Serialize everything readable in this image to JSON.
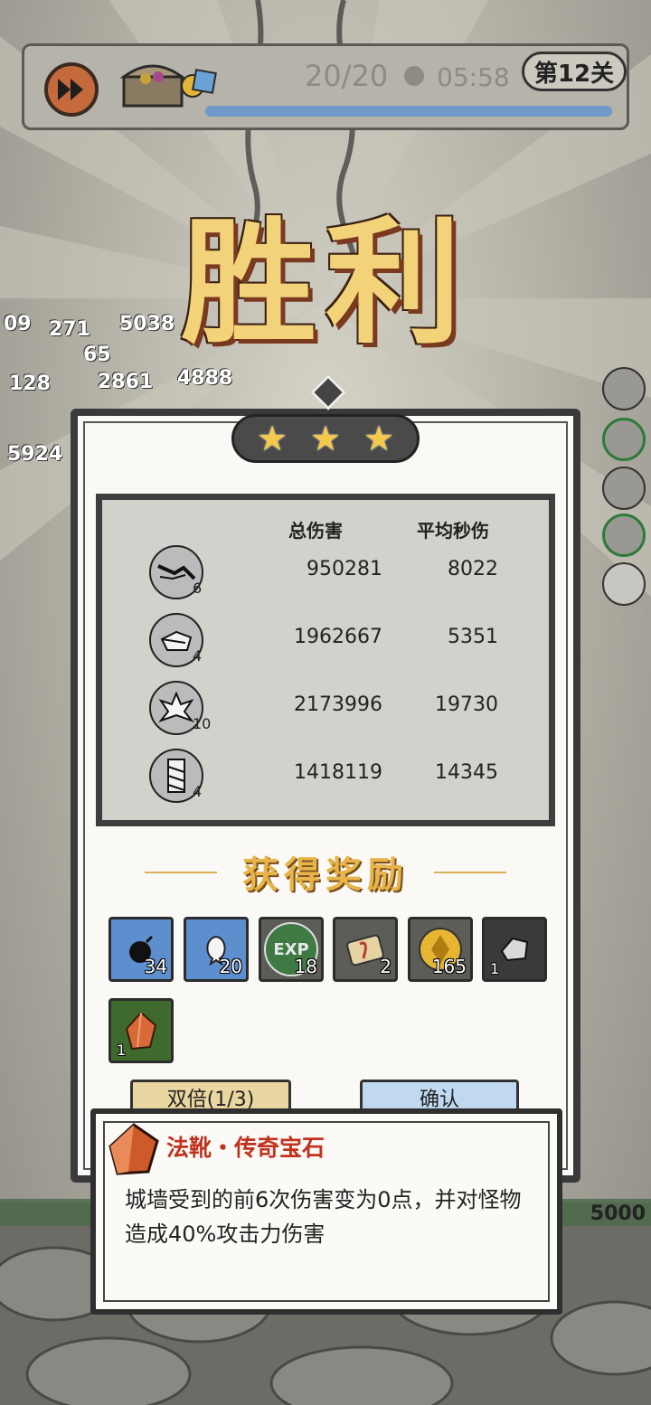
{
  "hud": {
    "wave": "20/20",
    "time": "05:58",
    "stage": "第12关"
  },
  "victory_text": "胜利",
  "floating_numbers": [
    "09",
    "271",
    "5038",
    "65",
    "2861",
    "4888",
    "128",
    "5924"
  ],
  "stars": 3,
  "stats": {
    "headers": [
      "总伤害",
      "平均秒伤"
    ],
    "rows": [
      {
        "icon": "crack-skill-icon",
        "level": "6",
        "total": "950281",
        "dps": "8022"
      },
      {
        "icon": "block-skill-icon",
        "level": "4",
        "total": "1962667",
        "dps": "5351"
      },
      {
        "icon": "ice-crystal-skill-icon",
        "level": "10",
        "total": "2173996",
        "dps": "19730"
      },
      {
        "icon": "drill-skill-icon",
        "level": "4",
        "total": "1418119",
        "dps": "14345"
      }
    ]
  },
  "rewards": {
    "title": "获得奖励",
    "items": [
      {
        "icon": "bomb-card-icon",
        "count": "34",
        "bg": "#5d8fcf"
      },
      {
        "icon": "spirit-card-icon",
        "count": "20",
        "bg": "#5d8fcf"
      },
      {
        "icon": "exp-icon",
        "count": "18",
        "bg": "#5d5d58",
        "label": "EXP"
      },
      {
        "icon": "scroll-icon",
        "count": "2",
        "bg": "#5d5d58"
      },
      {
        "icon": "gold-coin-icon",
        "count": "165",
        "bg": "#5d5d58"
      },
      {
        "icon": "gray-stone-icon",
        "count": "1",
        "bg": "#3a3a38"
      },
      {
        "icon": "orange-gem-icon",
        "count": "1",
        "bg": "#3f6a2d"
      }
    ]
  },
  "buttons": {
    "double": "双倍(1/3)",
    "confirm": "确认"
  },
  "tooltip": {
    "title": "法靴・传奇宝石",
    "description": "城墙受到的前6次伤害变为0点，并对怪物造成40%攻击力伤害"
  },
  "wall_hp": "5000"
}
